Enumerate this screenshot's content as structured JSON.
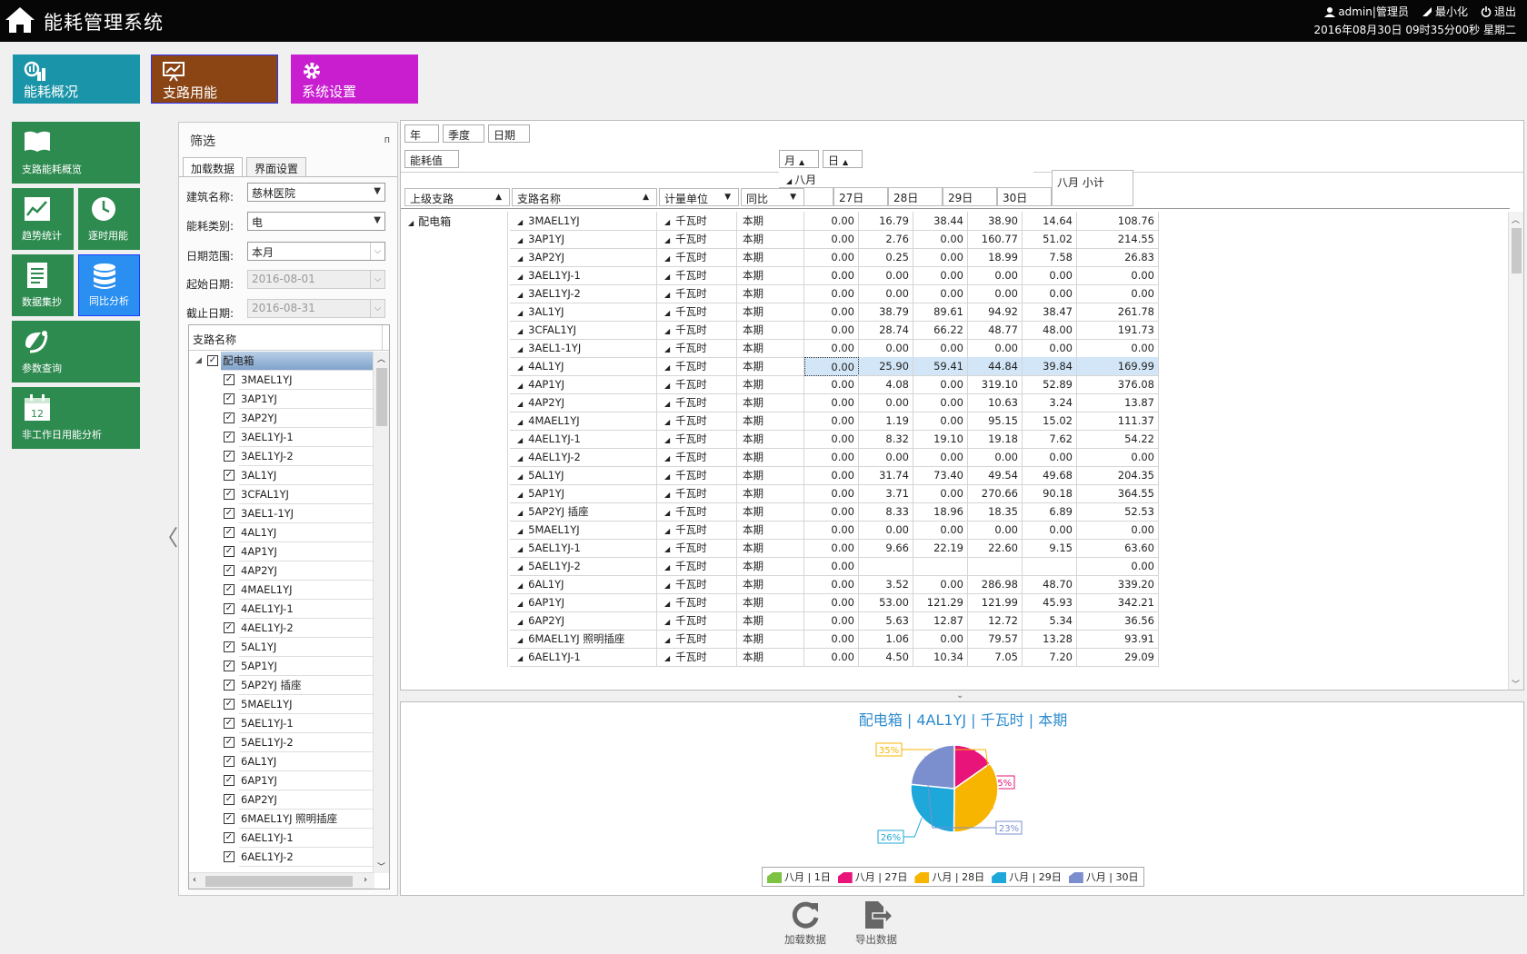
{
  "app": {
    "title": "能耗管理系统"
  },
  "user": {
    "admin_label": "admin|管理员",
    "minimize": "最小化",
    "logout": "退出",
    "datetime": "2016年08月30日 09时35分00秒 星期二"
  },
  "nav": [
    {
      "label": "能耗概况",
      "color": "#1a94a8"
    },
    {
      "label": "支路用能",
      "color": "#8b4515"
    },
    {
      "label": "系统设置",
      "color": "#c81ed0"
    }
  ],
  "side": [
    {
      "label": "支路能耗概览",
      "icon": "book-icon"
    },
    {
      "label": "趋势统计",
      "icon": "trend-chart-icon"
    },
    {
      "label": "逐时用能",
      "icon": "clock-icon"
    },
    {
      "label": "数据集抄",
      "icon": "document-icon"
    },
    {
      "label": "同比分析",
      "icon": "database-icon"
    },
    {
      "label": "参数查询",
      "icon": "satellite-icon"
    },
    {
      "label": "非工作日用能分析",
      "icon": "calendar-icon"
    }
  ],
  "calendar_day": "12",
  "filter": {
    "title": "筛选",
    "pin": "ᴨ",
    "tabs": [
      "加载数据",
      "界面设置"
    ],
    "building_label": "建筑名称:",
    "building": "慈林医院",
    "type_label": "能耗类别:",
    "type": "电",
    "range_label": "日期范围:",
    "range": "本月",
    "start_label": "起始日期:",
    "start": "2016-08-01",
    "end_label": "截止日期:",
    "end": "2016-08-31",
    "tree_header": "支路名称",
    "root": "配电箱"
  },
  "tree_items": [
    "3MAEL1YJ",
    "3AP1YJ",
    "3AP2YJ",
    "3AEL1YJ-1",
    "3AEL1YJ-2",
    "3AL1YJ",
    "3CFAL1YJ",
    "3AEL1-1YJ",
    "4AL1YJ",
    "4AP1YJ",
    "4AP2YJ",
    "4MAEL1YJ",
    "4AEL1YJ-1",
    "4AEL1YJ-2",
    "5AL1YJ",
    "5AP1YJ",
    "5AP2YJ 插座",
    "5MAEL1YJ",
    "5AEL1YJ-1",
    "5AEL1YJ-2",
    "6AL1YJ",
    "6AP1YJ",
    "6AP2YJ",
    "6MAEL1YJ 照明插座",
    "6AEL1YJ-1",
    "6AEL1YJ-2"
  ],
  "grid": {
    "chips": [
      "年",
      "季度",
      "日期"
    ],
    "value_chip": "能耗值",
    "month_chip": "月",
    "day_chip": "日",
    "month_group": "八月",
    "days": [
      "1日",
      "27日",
      "28日",
      "29日",
      "30日"
    ],
    "subtotal": "八月 小计",
    "col_headers": [
      "上级支路",
      "支路名称",
      "计量单位",
      "同比"
    ],
    "parent": "配电箱",
    "unit": "千瓦时",
    "period": "本期",
    "rows": [
      [
        "3MAEL1YJ",
        "0.00",
        "16.79",
        "38.44",
        "38.90",
        "14.64",
        "108.76"
      ],
      [
        "3AP1YJ",
        "0.00",
        "2.76",
        "0.00",
        "160.77",
        "51.02",
        "214.55"
      ],
      [
        "3AP2YJ",
        "0.00",
        "0.25",
        "0.00",
        "18.99",
        "7.58",
        "26.83"
      ],
      [
        "3AEL1YJ-1",
        "0.00",
        "0.00",
        "0.00",
        "0.00",
        "0.00",
        "0.00"
      ],
      [
        "3AEL1YJ-2",
        "0.00",
        "0.00",
        "0.00",
        "0.00",
        "0.00",
        "0.00"
      ],
      [
        "3AL1YJ",
        "0.00",
        "38.79",
        "89.61",
        "94.92",
        "38.47",
        "261.78"
      ],
      [
        "3CFAL1YJ",
        "0.00",
        "28.74",
        "66.22",
        "48.77",
        "48.00",
        "191.73"
      ],
      [
        "3AEL1-1YJ",
        "0.00",
        "0.00",
        "0.00",
        "0.00",
        "0.00",
        "0.00"
      ],
      [
        "4AL1YJ",
        "0.00",
        "25.90",
        "59.41",
        "44.84",
        "39.84",
        "169.99"
      ],
      [
        "4AP1YJ",
        "0.00",
        "4.08",
        "0.00",
        "319.10",
        "52.89",
        "376.08"
      ],
      [
        "4AP2YJ",
        "0.00",
        "0.00",
        "0.00",
        "10.63",
        "3.24",
        "13.87"
      ],
      [
        "4MAEL1YJ",
        "0.00",
        "1.19",
        "0.00",
        "95.15",
        "15.02",
        "111.37"
      ],
      [
        "4AEL1YJ-1",
        "0.00",
        "8.32",
        "19.10",
        "19.18",
        "7.62",
        "54.22"
      ],
      [
        "4AEL1YJ-2",
        "0.00",
        "0.00",
        "0.00",
        "0.00",
        "0.00",
        "0.00"
      ],
      [
        "5AL1YJ",
        "0.00",
        "31.74",
        "73.40",
        "49.54",
        "49.68",
        "204.35"
      ],
      [
        "5AP1YJ",
        "0.00",
        "3.71",
        "0.00",
        "270.66",
        "90.18",
        "364.55"
      ],
      [
        "5AP2YJ 插座",
        "0.00",
        "8.33",
        "18.96",
        "18.35",
        "6.89",
        "52.53"
      ],
      [
        "5MAEL1YJ",
        "0.00",
        "0.00",
        "0.00",
        "0.00",
        "0.00",
        "0.00"
      ],
      [
        "5AEL1YJ-1",
        "0.00",
        "9.66",
        "22.19",
        "22.60",
        "9.15",
        "63.60"
      ],
      [
        "5AEL1YJ-2",
        "0.00",
        "",
        "",
        "",
        "",
        "0.00"
      ],
      [
        "6AL1YJ",
        "0.00",
        "3.52",
        "0.00",
        "286.98",
        "48.70",
        "339.20"
      ],
      [
        "6AP1YJ",
        "0.00",
        "53.00",
        "121.29",
        "121.99",
        "45.93",
        "342.21"
      ],
      [
        "6AP2YJ",
        "0.00",
        "5.63",
        "12.87",
        "12.72",
        "5.34",
        "36.56"
      ],
      [
        "6MAEL1YJ 照明插座",
        "0.00",
        "1.06",
        "0.00",
        "79.57",
        "13.28",
        "93.91"
      ],
      [
        "6AEL1YJ-1",
        "0.00",
        "4.50",
        "10.34",
        "7.05",
        "7.20",
        "29.09"
      ]
    ],
    "highlight_row": 8
  },
  "chart_data": {
    "type": "pie",
    "title": "配电箱 | 4AL1YJ | 千瓦时 | 本期",
    "categories": [
      "八月 | 1日",
      "八月 | 27日",
      "八月 | 28日",
      "八月 | 29日",
      "八月 | 30日"
    ],
    "values": [
      0.0,
      25.9,
      59.41,
      44.84,
      39.84
    ],
    "data_labels": [
      "",
      "15%",
      "35%",
      "26%",
      "23%"
    ],
    "colors": [
      "#7dc242",
      "#e8147a",
      "#f7b500",
      "#1ea7d9",
      "#7b8fcf"
    ],
    "legend_position": "bottom"
  },
  "actions": {
    "load": "加载数据",
    "export": "导出数据"
  }
}
